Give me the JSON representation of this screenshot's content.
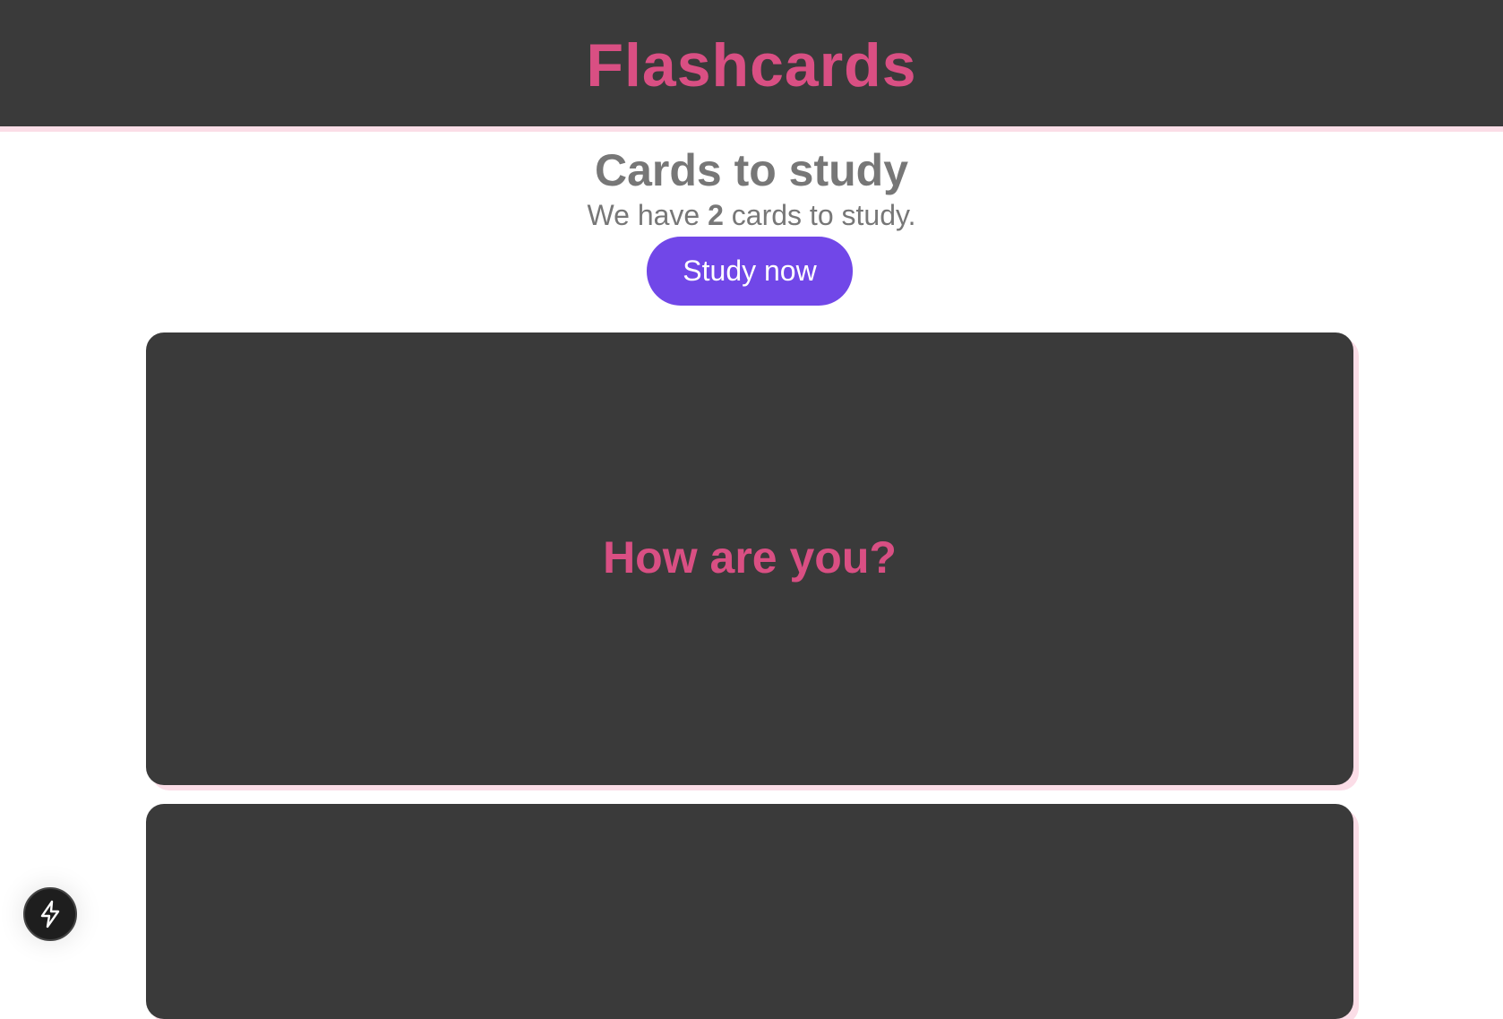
{
  "header": {
    "title": "Flashcards"
  },
  "study": {
    "heading": "Cards to study",
    "summary_prefix": "We have ",
    "count": "2",
    "summary_suffix": " cards to study.",
    "button_label": "Study now"
  },
  "cards": [
    {
      "text": "How are you?"
    },
    {
      "text": ""
    }
  ],
  "devtools": {
    "icon": "lightning-bolt-icon"
  },
  "colors": {
    "header_bg": "#3a3a3a",
    "accent_pink": "#d94f83",
    "button_purple": "#7147e8",
    "shadow_pink": "#fbdde7",
    "muted_text": "#777777"
  }
}
